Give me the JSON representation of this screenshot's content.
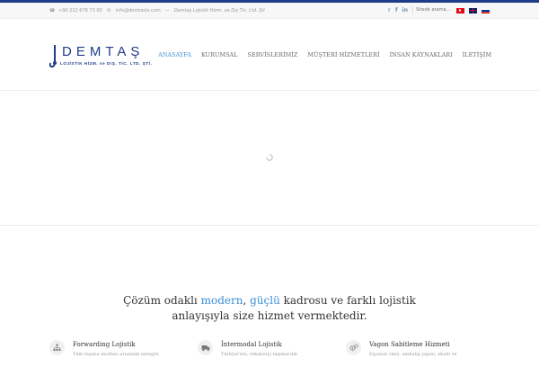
{
  "topbar": {
    "phone": "+90 212 678 73 00",
    "email": "info@demtasts.com",
    "separator": "—",
    "company": "Demtaş Lojistik Hizm. ve Dış Tic. Ltd. Şti",
    "search_placeholder": "Sitede arama...",
    "social_icons": [
      "twitter-icon",
      "facebook-icon",
      "linkedin-icon"
    ],
    "languages": [
      "tr-flag",
      "en-flag",
      "ru-flag"
    ]
  },
  "logo": {
    "brand": "DEMTAŞ",
    "sub": "LOJİSTİK HİZM. ve DIŞ. TİC. LTD. ŞTİ."
  },
  "nav": {
    "items": [
      "ANASAYFA",
      "KURUMSAL",
      "SERVİSLERİMİZ",
      "MÜŞTERİ HİZMETLERİ",
      "İNSAN KAYNAKLARI",
      "İLETİŞİM"
    ],
    "active_index": 0
  },
  "tagline": {
    "part1": "Çözüm odaklı ",
    "hl1": "modern",
    "part2": ", ",
    "hl2": "güçlü",
    "part3": " kadrosu ve farklı lojistik",
    "line2": "anlayışıyla size hizmet vermektedir."
  },
  "features": [
    {
      "icon": "network-icon",
      "title": "Forwarding Lojistik",
      "desc": "Tüm taşıma modları arasında entegre"
    },
    {
      "icon": "truck-icon",
      "title": "İntermodal Lojistik",
      "desc": "Türkiye'nin, rekabetçi taşımacılık"
    },
    {
      "icon": "gears-icon",
      "title": "Vagon Sabitleme Hizmeti",
      "desc": "Eşyanın cinsi, ambalaj yapısı, ebadı ve"
    }
  ],
  "colors": {
    "brand": "#1f3c88",
    "accent": "#3a8fd6",
    "text": "#333333"
  }
}
